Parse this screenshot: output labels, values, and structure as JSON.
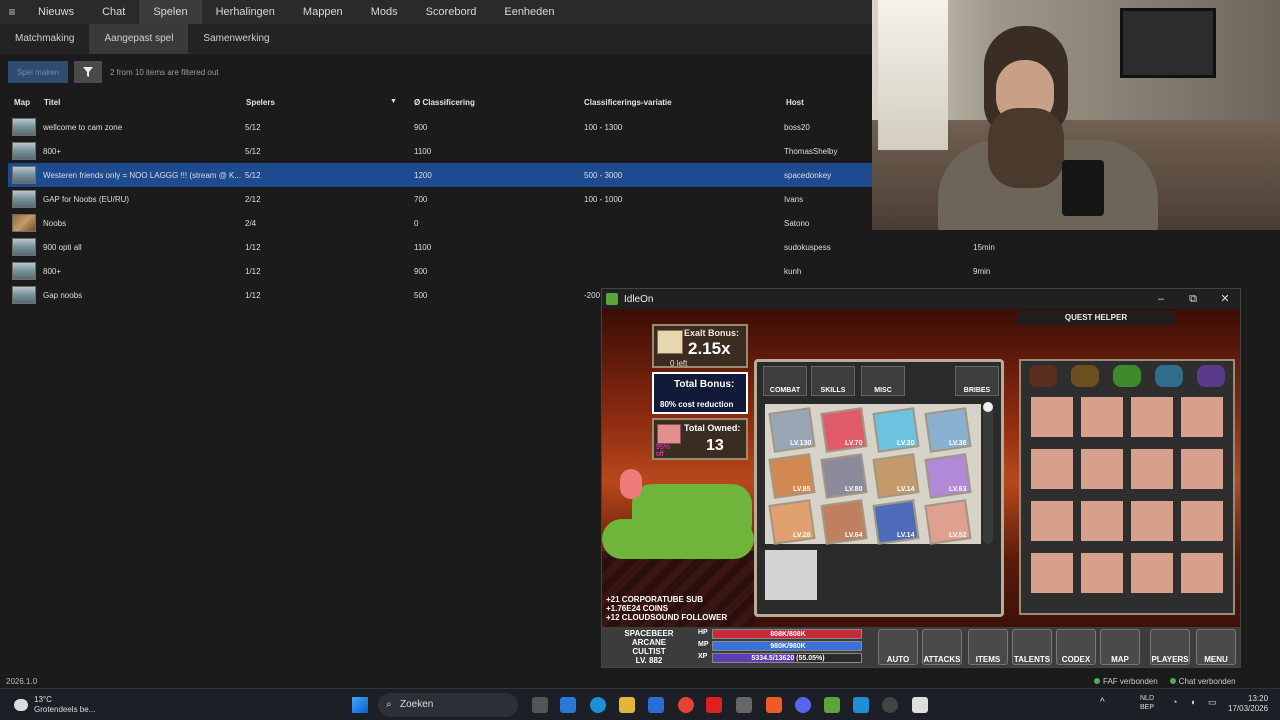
{
  "topnav": {
    "menu_icon": "hamburger-icon",
    "items": [
      "Nieuws",
      "Chat",
      "Spelen",
      "Herhalingen",
      "Mappen",
      "Mods",
      "Scorebord",
      "Eenheden"
    ],
    "active": "Spelen"
  },
  "subnav": {
    "items": [
      "Matchmaking",
      "Aangepast spel",
      "Samenwerking"
    ],
    "active": "Aangepast spel"
  },
  "toolbar": {
    "create_label": "Spel maken",
    "filter_icon": "filter-icon",
    "filter_info": "2 from 10 items are filtered out"
  },
  "table": {
    "headers": {
      "map": "Map",
      "title": "Titel",
      "players": "Spelers",
      "sort_icon": "▼",
      "rating": "Ø Classificering",
      "variation": "Classificerings-variatie",
      "host": "Host"
    },
    "rows": [
      {
        "title": "wellcome to cam zone",
        "players": "5/12",
        "rating": "900",
        "variation": "100 - 1300",
        "host": "boss20",
        "extra": "",
        "selected": false,
        "map": "snow"
      },
      {
        "title": "800+",
        "players": "5/12",
        "rating": "1100",
        "variation": "",
        "host": "ThomasShelby",
        "extra": "",
        "selected": false,
        "map": "snow"
      },
      {
        "title": "Westeren friends only = NOO LAGGG !!! (stream @ K...",
        "players": "5/12",
        "rating": "1200",
        "variation": "500 - 3000",
        "host": "spacedonkey",
        "extra": "",
        "selected": true,
        "map": "snow"
      },
      {
        "title": "GAP for Noobs (EU/RU)",
        "players": "2/12",
        "rating": "700",
        "variation": "100 - 1000",
        "host": "Ivans",
        "extra": "",
        "selected": false,
        "map": "snow"
      },
      {
        "title": "Noobs",
        "players": "2/4",
        "rating": "0",
        "variation": "",
        "host": "Satono",
        "extra": "",
        "selected": false,
        "map": "desert"
      },
      {
        "title": "900 opti all",
        "players": "1/12",
        "rating": "1100",
        "variation": "",
        "host": "sudokuspess",
        "extra": "15min",
        "selected": false,
        "map": "snow"
      },
      {
        "title": "800+",
        "players": "1/12",
        "rating": "900",
        "variation": "",
        "host": "kunh",
        "extra": "9min",
        "selected": false,
        "map": "snow"
      },
      {
        "title": "Gap noobs",
        "players": "1/12",
        "rating": "500",
        "variation": "-200",
        "host": "",
        "extra": "",
        "selected": false,
        "map": "snow"
      }
    ]
  },
  "status": {
    "version": "2026.1.0",
    "faf": "FAF verbonden",
    "chat": "Chat verbonden",
    "color_ok": "#4caf50"
  },
  "game": {
    "title": "IdleOn",
    "exalt": {
      "label": "Exalt Bonus:",
      "value": "2.15x",
      "left": "0 left"
    },
    "total_bonus": {
      "label": "Total Bonus:",
      "sub": "80% cost reduction"
    },
    "total_owned": {
      "label": "Total Owned:",
      "value": "13",
      "pct": "95%\noff"
    },
    "tabs": [
      "COMBAT",
      "SKILLS",
      "MISC",
      "BRIBES"
    ],
    "items": [
      {
        "lv": "LV.130"
      },
      {
        "lv": "LV.70"
      },
      {
        "lv": "LV.30"
      },
      {
        "lv": "LV.36"
      },
      {
        "lv": "LV.85"
      },
      {
        "lv": "LV.80"
      },
      {
        "lv": "LV.14"
      },
      {
        "lv": "LV.63"
      },
      {
        "lv": "LV.28"
      },
      {
        "lv": "LV.64"
      },
      {
        "lv": "LV.14"
      },
      {
        "lv": "LV.52"
      }
    ],
    "quest_helper": "QUEST HELPER",
    "chat_log": [
      "+21 CORPORATUBE SUB",
      "+1.76E24 COINS",
      "+12 CLOUDSOUND FOLLOWER"
    ],
    "player": {
      "name_lines": [
        "SPACEBEER",
        "ARCANE",
        "CULTIST",
        "LV. 882"
      ],
      "hp": "808K/808K",
      "mp": "980K/980K",
      "xp": "5334.5/13620 (55.05%)"
    },
    "buttons": [
      "AUTO",
      "ATTACKS",
      "ITEMS",
      "TALENTS",
      "CODEX",
      "MAP",
      "PLAYERS",
      "MENU"
    ]
  },
  "taskbar": {
    "temp": "13°C",
    "weather": "Grotendeels be...",
    "search": "Zoeken",
    "lang": [
      "NLD",
      "BEP"
    ],
    "time": "13:20",
    "date": "17/03/2026"
  }
}
